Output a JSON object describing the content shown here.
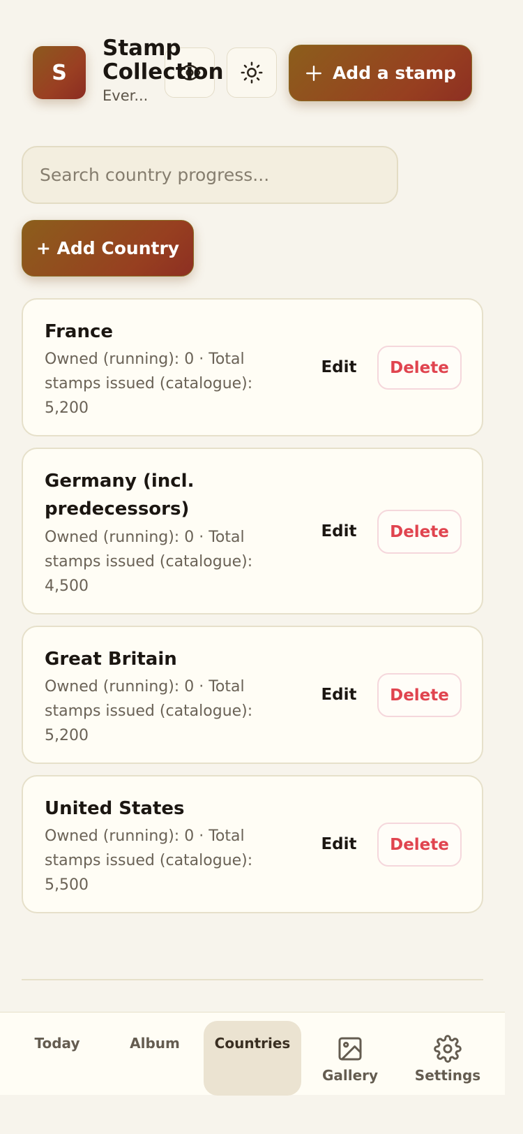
{
  "header": {
    "badge_letter": "S",
    "title": "Stamp Collection",
    "subtitle": "Ever...",
    "add_stamp_label": "Add a stamp"
  },
  "search": {
    "placeholder": "Search country progress..."
  },
  "add_country_label": "+ Add Country",
  "countries": [
    {
      "name": "France",
      "meta": "Owned (running): 0 · Total stamps issued (catalogue): 5,200",
      "edit": "Edit",
      "delete": "Delete"
    },
    {
      "name": "Germany (incl. predecessors)",
      "meta": "Owned (running): 0 · Total stamps issued (catalogue): 4,500",
      "edit": "Edit",
      "delete": "Delete"
    },
    {
      "name": "Great Britain",
      "meta": "Owned (running): 0 · Total stamps issued (catalogue): 5,200",
      "edit": "Edit",
      "delete": "Delete"
    },
    {
      "name": "United States",
      "meta": "Owned (running): 0 · Total stamps issued (catalogue): 5,500",
      "edit": "Edit",
      "delete": "Delete"
    }
  ],
  "nav": {
    "today": "Today",
    "album": "Album",
    "countries": "Countries",
    "gallery": "Gallery",
    "settings": "Settings",
    "active": "countries"
  },
  "colors": {
    "accent_start": "#8c5e1c",
    "accent_end": "#8d2f22",
    "delete": "#e0444f",
    "background": "#f7f4ec"
  }
}
